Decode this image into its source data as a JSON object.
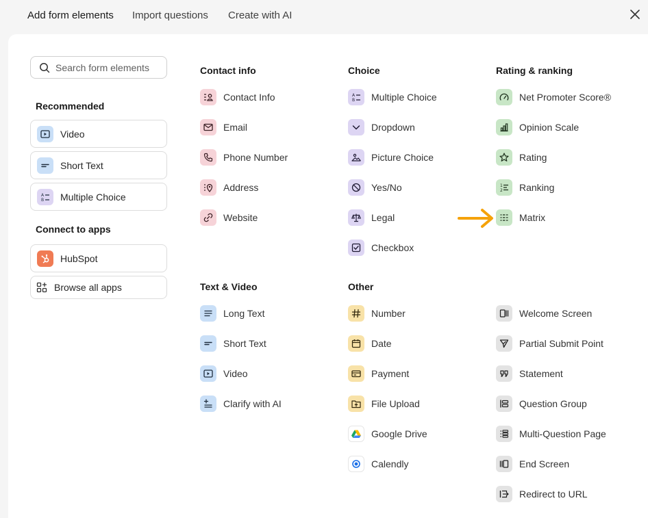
{
  "tabs": [
    {
      "label": "Add form elements"
    },
    {
      "label": "Import questions"
    },
    {
      "label": "Create with AI"
    }
  ],
  "search": {
    "placeholder": "Search form elements"
  },
  "sidebar": {
    "recommended_heading": "Recommended",
    "recommended": [
      {
        "label": "Video",
        "icon": "video-icon"
      },
      {
        "label": "Short Text",
        "icon": "short-text-icon"
      },
      {
        "label": "Multiple Choice",
        "icon": "multiple-choice-icon"
      }
    ],
    "apps_heading": "Connect to apps",
    "apps": [
      {
        "label": "HubSpot",
        "icon": "hubspot-icon"
      },
      {
        "label": "Browse all apps",
        "icon": "apps-grid-icon"
      }
    ]
  },
  "groups": {
    "contact": {
      "heading": "Contact info",
      "items": [
        "Contact Info",
        "Email",
        "Phone Number",
        "Address",
        "Website"
      ]
    },
    "choice": {
      "heading": "Choice",
      "items": [
        "Multiple Choice",
        "Dropdown",
        "Picture Choice",
        "Yes/No",
        "Legal",
        "Checkbox"
      ]
    },
    "rating": {
      "heading": "Rating & ranking",
      "items": [
        "Net Promoter Score®",
        "Opinion Scale",
        "Rating",
        "Ranking",
        "Matrix"
      ]
    },
    "text_video": {
      "heading": "Text & Video",
      "items": [
        "Long Text",
        "Short Text",
        "Video",
        "Clarify with AI"
      ]
    },
    "other": {
      "heading": "Other",
      "items": [
        "Number",
        "Date",
        "Payment",
        "File Upload",
        "Google Drive",
        "Calendly"
      ]
    },
    "structure": {
      "items": [
        "Welcome Screen",
        "Partial Submit Point",
        "Statement",
        "Question Group",
        "Multi-Question Page",
        "End Screen",
        "Redirect to URL"
      ]
    }
  },
  "colors": {
    "contact": "#f6d3d8",
    "choice": "#ddd5f3",
    "rating": "#c8e6c6",
    "text_video": "#c9dff7",
    "other": "#f8e2a8",
    "structure": "#e3e3e3",
    "hubspot": "#f07b54",
    "annotation_arrow": "#f5a20a"
  }
}
